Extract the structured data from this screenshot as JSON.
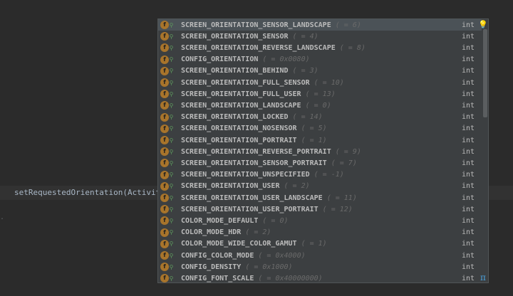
{
  "editor": {
    "code_line": "setRequestedOrientation(Activity",
    "gutter_mark": "."
  },
  "popup": {
    "selected_index": 0,
    "items": [
      {
        "name": "SCREEN_ORIENTATION_SENSOR_LANDSCAPE",
        "value": " ( = 6)",
        "type": "int"
      },
      {
        "name": "SCREEN_ORIENTATION_SENSOR",
        "value": " ( = 4)",
        "type": "int"
      },
      {
        "name": "SCREEN_ORIENTATION_REVERSE_LANDSCAPE",
        "value": " ( = 8)",
        "type": "int"
      },
      {
        "name": "CONFIG_ORIENTATION",
        "value": " ( = 0x0080)",
        "type": "int"
      },
      {
        "name": "SCREEN_ORIENTATION_BEHIND",
        "value": " ( = 3)",
        "type": "int"
      },
      {
        "name": "SCREEN_ORIENTATION_FULL_SENSOR",
        "value": " ( = 10)",
        "type": "int"
      },
      {
        "name": "SCREEN_ORIENTATION_FULL_USER",
        "value": " ( = 13)",
        "type": "int"
      },
      {
        "name": "SCREEN_ORIENTATION_LANDSCAPE",
        "value": " ( = 0)",
        "type": "int"
      },
      {
        "name": "SCREEN_ORIENTATION_LOCKED",
        "value": " ( = 14)",
        "type": "int"
      },
      {
        "name": "SCREEN_ORIENTATION_NOSENSOR",
        "value": " ( = 5)",
        "type": "int"
      },
      {
        "name": "SCREEN_ORIENTATION_PORTRAIT",
        "value": " ( = 1)",
        "type": "int"
      },
      {
        "name": "SCREEN_ORIENTATION_REVERSE_PORTRAIT",
        "value": " ( = 9)",
        "type": "int"
      },
      {
        "name": "SCREEN_ORIENTATION_SENSOR_PORTRAIT",
        "value": " ( = 7)",
        "type": "int"
      },
      {
        "name": "SCREEN_ORIENTATION_UNSPECIFIED",
        "value": " ( = -1)",
        "type": "int"
      },
      {
        "name": "SCREEN_ORIENTATION_USER",
        "value": " ( = 2)",
        "type": "int"
      },
      {
        "name": "SCREEN_ORIENTATION_USER_LANDSCAPE",
        "value": " ( = 11)",
        "type": "int"
      },
      {
        "name": "SCREEN_ORIENTATION_USER_PORTRAIT",
        "value": " ( = 12)",
        "type": "int"
      },
      {
        "name": "COLOR_MODE_DEFAULT",
        "value": " ( = 0)",
        "type": "int"
      },
      {
        "name": "COLOR_MODE_HDR",
        "value": " ( = 2)",
        "type": "int"
      },
      {
        "name": "COLOR_MODE_WIDE_COLOR_GAMUT",
        "value": " ( = 1)",
        "type": "int"
      },
      {
        "name": "CONFIG_COLOR_MODE",
        "value": " ( = 0x4000)",
        "type": "int"
      },
      {
        "name": "CONFIG_DENSITY",
        "value": " ( = 0x1000)",
        "type": "int"
      },
      {
        "name": "CONFIG_FONT_SCALE",
        "value": " ( = 0x40000000)",
        "type": "int"
      }
    ],
    "field_icon_glyph": "f",
    "static_icon_glyph": "⚲",
    "bulb_icon_glyph": "💡",
    "pi_icon_glyph": "π"
  },
  "colors": {
    "editor_bg": "#2b2b2b",
    "popup_bg": "#3c3f41",
    "selected_row_bg": "#4b5257",
    "field_icon": "#a8742b",
    "value_text": "#6a6a6a",
    "pi_icon": "#4aa3df"
  }
}
